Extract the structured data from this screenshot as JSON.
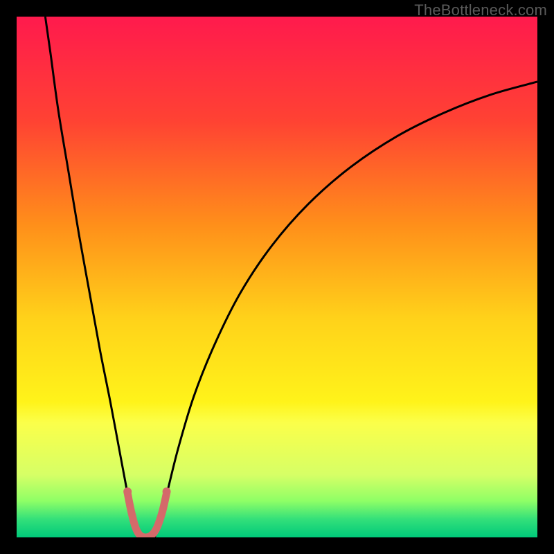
{
  "watermark": "TheBottleneck.com",
  "chart_data": {
    "type": "line",
    "title": "",
    "xlabel": "",
    "ylabel": "",
    "xlim": [
      0,
      100
    ],
    "ylim": [
      0,
      100
    ],
    "background_gradient": [
      {
        "pos": 0.0,
        "color": "#ff1a4d"
      },
      {
        "pos": 0.2,
        "color": "#ff4233"
      },
      {
        "pos": 0.4,
        "color": "#ff8f1a"
      },
      {
        "pos": 0.58,
        "color": "#ffd21a"
      },
      {
        "pos": 0.74,
        "color": "#fff31a"
      },
      {
        "pos": 0.78,
        "color": "#fbff4a"
      },
      {
        "pos": 0.88,
        "color": "#d6ff66"
      },
      {
        "pos": 0.93,
        "color": "#8fff66"
      },
      {
        "pos": 0.965,
        "color": "#33e07a"
      },
      {
        "pos": 1.0,
        "color": "#00c97a"
      }
    ],
    "series": [
      {
        "name": "left-curve",
        "stroke": "#000000",
        "stroke_width": 3,
        "points": [
          {
            "x": 5.5,
            "y": 100
          },
          {
            "x": 6.5,
            "y": 93
          },
          {
            "x": 8,
            "y": 82
          },
          {
            "x": 10,
            "y": 70
          },
          {
            "x": 12,
            "y": 58
          },
          {
            "x": 14,
            "y": 47
          },
          {
            "x": 16,
            "y": 36
          },
          {
            "x": 18,
            "y": 26
          },
          {
            "x": 19.5,
            "y": 18
          },
          {
            "x": 21,
            "y": 10
          },
          {
            "x": 22,
            "y": 5
          },
          {
            "x": 22.8,
            "y": 2
          },
          {
            "x": 23.5,
            "y": 0
          }
        ]
      },
      {
        "name": "right-curve",
        "stroke": "#000000",
        "stroke_width": 3,
        "points": [
          {
            "x": 26.5,
            "y": 0
          },
          {
            "x": 27.5,
            "y": 3
          },
          {
            "x": 29,
            "y": 9
          },
          {
            "x": 31,
            "y": 17
          },
          {
            "x": 34,
            "y": 27
          },
          {
            "x": 38,
            "y": 37
          },
          {
            "x": 43,
            "y": 47
          },
          {
            "x": 49,
            "y": 56
          },
          {
            "x": 56,
            "y": 64
          },
          {
            "x": 64,
            "y": 71
          },
          {
            "x": 73,
            "y": 77
          },
          {
            "x": 82,
            "y": 81.5
          },
          {
            "x": 91,
            "y": 85
          },
          {
            "x": 100,
            "y": 87.5
          }
        ]
      },
      {
        "name": "bottom-marker",
        "stroke": "#d46a6a",
        "stroke_width": 11,
        "linecap": "round",
        "points": [
          {
            "x": 21.3,
            "y": 8.5
          },
          {
            "x": 22.0,
            "y": 5.0
          },
          {
            "x": 22.8,
            "y": 2.0
          },
          {
            "x": 23.6,
            "y": 0.5
          },
          {
            "x": 24.8,
            "y": 0.0
          },
          {
            "x": 26.0,
            "y": 0.5
          },
          {
            "x": 27.0,
            "y": 2.0
          },
          {
            "x": 28.0,
            "y": 5.0
          },
          {
            "x": 28.8,
            "y": 8.5
          }
        ]
      }
    ],
    "marker_dots": {
      "color": "#d46a6a",
      "radius": 6,
      "points": [
        {
          "x": 21.3,
          "y": 8.8
        },
        {
          "x": 28.8,
          "y": 8.8
        }
      ]
    }
  }
}
